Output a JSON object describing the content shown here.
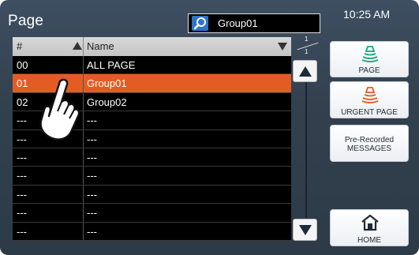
{
  "header": {
    "title": "Page",
    "search": {
      "value": "Group01"
    },
    "clock": "10:25 AM"
  },
  "table": {
    "columns": {
      "number": "#",
      "name": "Name"
    },
    "rows": [
      {
        "num": "00",
        "name": "ALL PAGE",
        "selected": false
      },
      {
        "num": "01",
        "name": "Group01",
        "selected": true
      },
      {
        "num": "02",
        "name": "Group02",
        "selected": false
      },
      {
        "num": "---",
        "name": "---",
        "selected": false
      },
      {
        "num": "---",
        "name": "---",
        "selected": false
      },
      {
        "num": "---",
        "name": "---",
        "selected": false
      },
      {
        "num": "---",
        "name": "---",
        "selected": false
      },
      {
        "num": "---",
        "name": "---",
        "selected": false
      },
      {
        "num": "---",
        "name": "---",
        "selected": false
      },
      {
        "num": "---",
        "name": "---",
        "selected": false
      }
    ]
  },
  "pagination": {
    "current": "1",
    "total": "1"
  },
  "side_buttons": {
    "page": "PAGE",
    "urgent_page": "URGENT PAGE",
    "recorded_line1": "Pre-Recorded",
    "recorded_line2": "MESSAGES",
    "home": "HOME"
  },
  "icons": {
    "search": "search-icon",
    "page": "speaker-page-icon",
    "urgent": "speaker-urgent-icon",
    "home": "home-icon",
    "scroll_up": "arrow-up-icon",
    "scroll_down": "arrow-down-icon",
    "cursor": "hand-pointer-icon"
  },
  "colors": {
    "selected_row": "#e35c23",
    "page_icon": "#1aa37a",
    "urgent_icon": "#e35c23",
    "search_icon_bg": "#2f74c9"
  }
}
